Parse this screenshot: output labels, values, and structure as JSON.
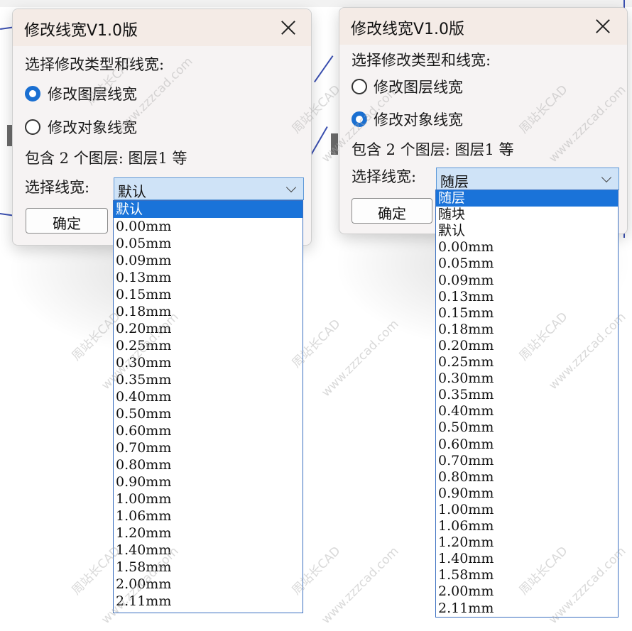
{
  "left_dialog": {
    "title": "修改线宽V1.0版",
    "prompt": "选择修改类型和线宽:",
    "radio_layer_label": "修改图层线宽",
    "radio_object_label": "修改对象线宽",
    "selected_option": "修改图层线宽",
    "info": "包含 2 个图层: 图层1 等",
    "lineweight_label": "选择线宽:",
    "combo_value": "默认",
    "ok_label": "确定",
    "options": [
      "默认",
      "0.00mm",
      "0.05mm",
      "0.09mm",
      "0.13mm",
      "0.15mm",
      "0.18mm",
      "0.20mm",
      "0.25mm",
      "0.30mm",
      "0.35mm",
      "0.40mm",
      "0.50mm",
      "0.60mm",
      "0.70mm",
      "0.80mm",
      "0.90mm",
      "1.00mm",
      "1.06mm",
      "1.20mm",
      "1.40mm",
      "1.58mm",
      "2.00mm",
      "2.11mm"
    ],
    "highlighted": "默认"
  },
  "right_dialog": {
    "title": "修改线宽V1.0版",
    "prompt": "选择修改类型和线宽:",
    "radio_layer_label": "修改图层线宽",
    "radio_object_label": "修改对象线宽",
    "selected_option": "修改对象线宽",
    "info": "包含 2 个图层: 图层1 等",
    "lineweight_label": "选择线宽:",
    "combo_value": "随层",
    "ok_label": "确定",
    "options": [
      "随层",
      "随块",
      "默认",
      "0.00mm",
      "0.05mm",
      "0.09mm",
      "0.13mm",
      "0.15mm",
      "0.18mm",
      "0.20mm",
      "0.25mm",
      "0.30mm",
      "0.35mm",
      "0.40mm",
      "0.50mm",
      "0.60mm",
      "0.70mm",
      "0.80mm",
      "0.90mm",
      "1.00mm",
      "1.06mm",
      "1.20mm",
      "1.40mm",
      "1.58mm",
      "2.00mm",
      "2.11mm"
    ],
    "highlighted": "随层"
  },
  "watermarks": [
    "周站长CAD",
    "www.zzzcad.com"
  ],
  "colors": {
    "accent": "#1a73d9",
    "title_bar": "#f4ebe6",
    "dialog_bg": "#f6f3f3"
  }
}
